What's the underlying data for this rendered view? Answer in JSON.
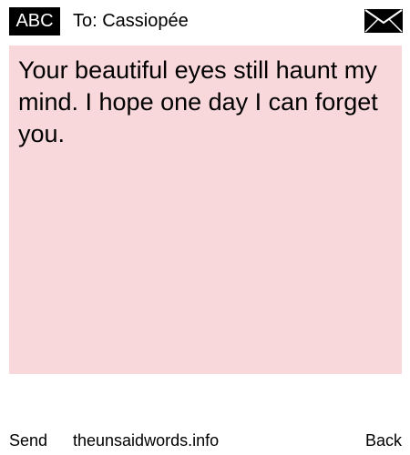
{
  "header": {
    "badge_label": "ABC",
    "recipient_line": "To: Cassiopée",
    "envelope_icon": "envelope-icon"
  },
  "message": {
    "body": "Your beautiful eyes still haunt my mind. I hope one day I can forget you.",
    "background_color": "#f9d8dc"
  },
  "footer": {
    "send_label": "Send",
    "site_label": "theunsaidwords.info",
    "back_label": "Back"
  }
}
